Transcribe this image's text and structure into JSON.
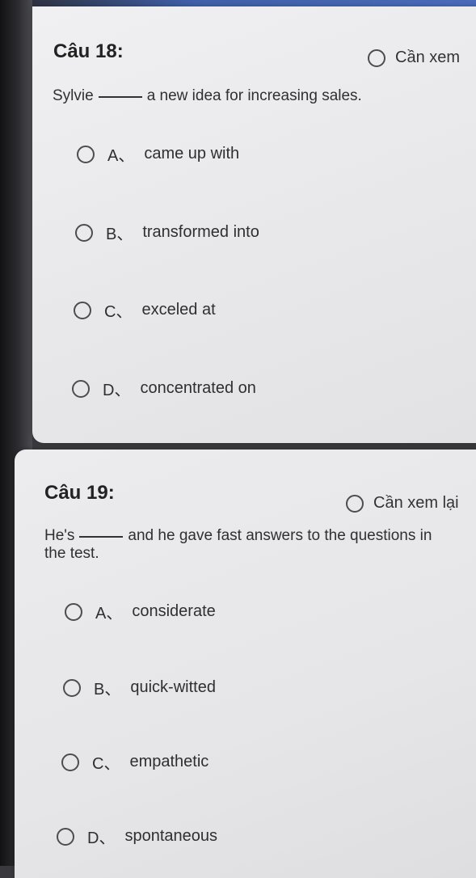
{
  "questions": [
    {
      "title": "Câu 18:",
      "review_label": "Cần xem",
      "stem_before": "Sylvie",
      "stem_after": "a new idea for increasing sales.",
      "options": [
        {
          "letter": "A、",
          "text": "came up with"
        },
        {
          "letter": "B、",
          "text": "transformed into"
        },
        {
          "letter": "C、",
          "text": "exceled at"
        },
        {
          "letter": "D、",
          "text": "concentrated on"
        }
      ]
    },
    {
      "title": "Câu 19:",
      "review_label": "Cần xem lại",
      "stem_before": "He's",
      "stem_after": "and he gave fast answers to the questions in",
      "stem_line2": "the test.",
      "options": [
        {
          "letter": "A、",
          "text": "considerate"
        },
        {
          "letter": "B、",
          "text": "quick-witted"
        },
        {
          "letter": "C、",
          "text": "empathetic"
        },
        {
          "letter": "D、",
          "text": "spontaneous"
        }
      ]
    }
  ]
}
